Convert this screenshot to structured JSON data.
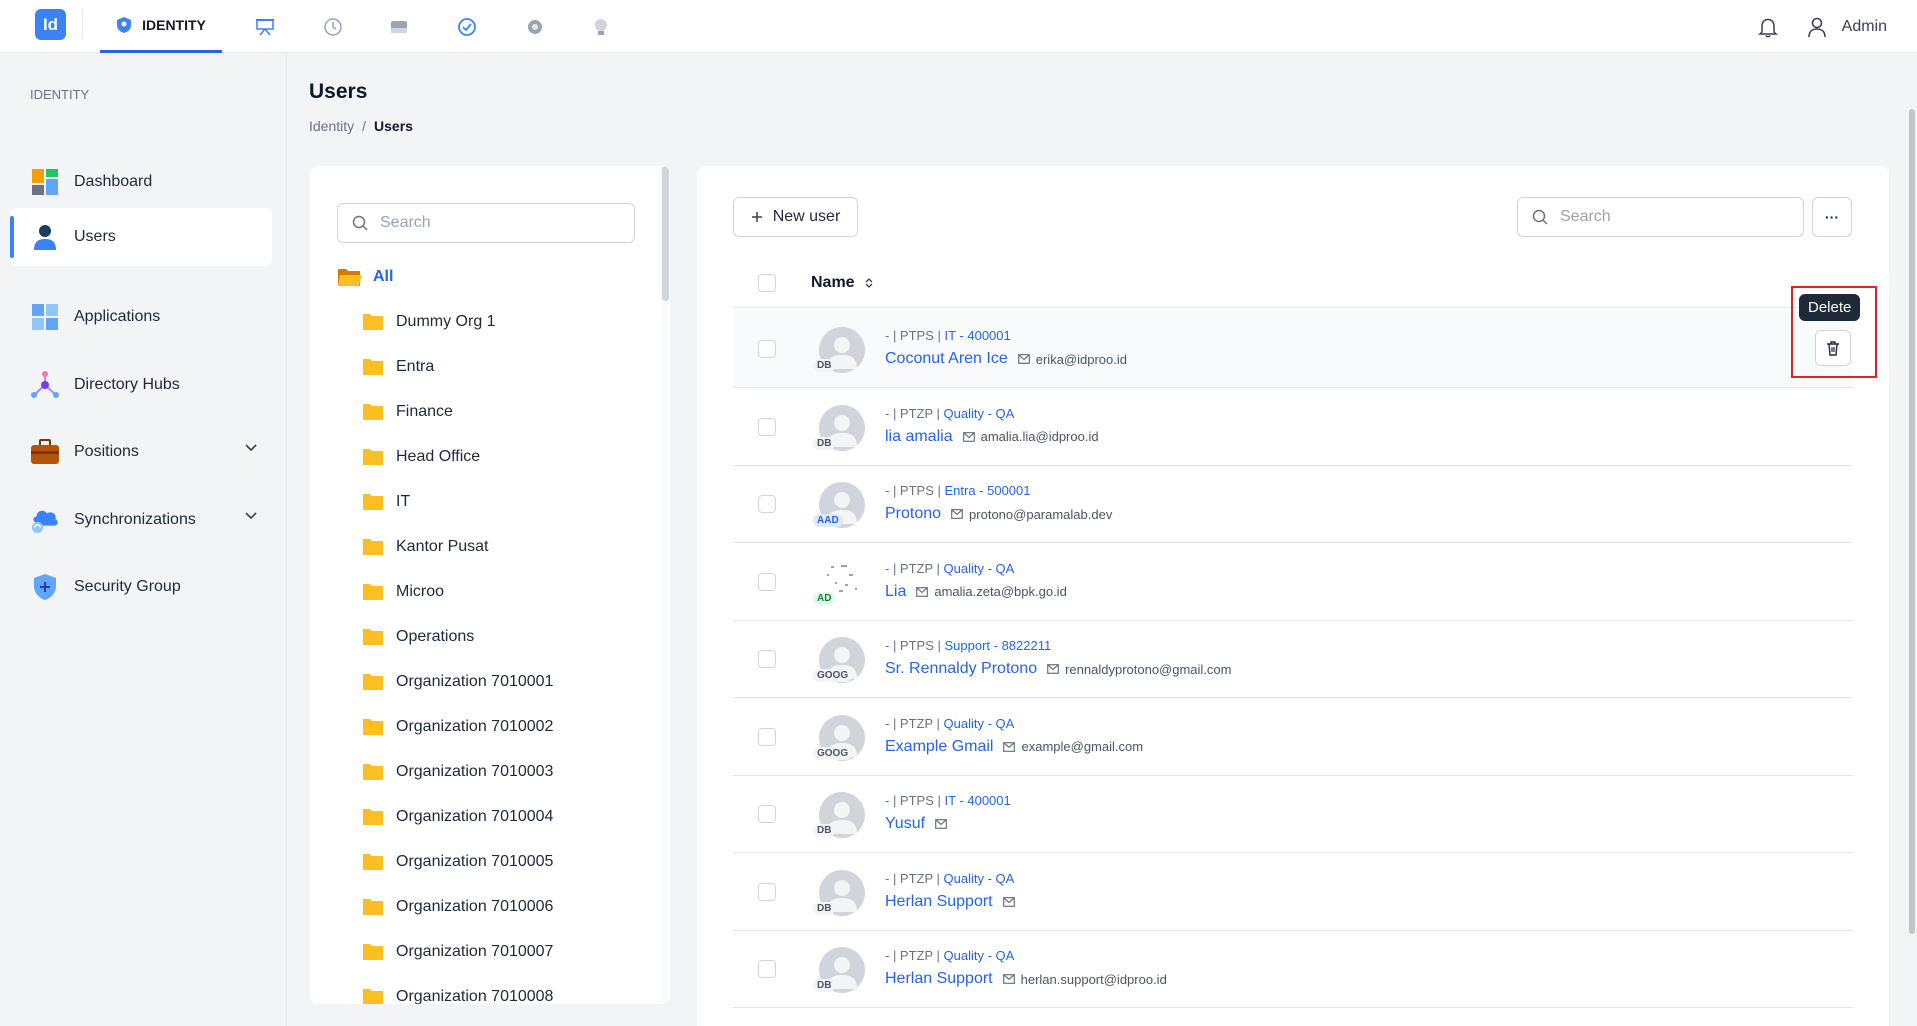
{
  "topbar": {
    "logo": "Id",
    "active_tab": "IDENTITY",
    "icons": [
      "shield-icon",
      "presentation-icon",
      "clock-icon",
      "drive-icon",
      "badge-check-icon",
      "gear-icon",
      "lightbulb-icon"
    ],
    "user": "Admin"
  },
  "sidebar": {
    "section": "IDENTITY",
    "items": [
      {
        "label": "Dashboard",
        "icon": "dashboard-icon"
      },
      {
        "label": "Users",
        "icon": "user-icon",
        "active": true
      },
      {
        "label": "Applications",
        "icon": "apps-icon"
      },
      {
        "label": "Directory Hubs",
        "icon": "hub-icon"
      },
      {
        "label": "Positions",
        "icon": "briefcase-icon",
        "expandable": true
      },
      {
        "label": "Synchronizations",
        "icon": "cloud-sync-icon",
        "expandable": true
      },
      {
        "label": "Security Group",
        "icon": "shield-plus-icon"
      }
    ]
  },
  "page": {
    "title": "Users",
    "breadcrumb": [
      "Identity",
      "/",
      "Users"
    ]
  },
  "tree": {
    "search_placeholder": "Search",
    "all_label": "All",
    "folders": [
      "Dummy Org 1",
      "Entra",
      "Finance",
      "Head Office",
      "IT",
      "Kantor Pusat",
      "Microo",
      "Operations",
      "Organization 7010001",
      "Organization 7010002",
      "Organization 7010003",
      "Organization 7010004",
      "Organization 7010005",
      "Organization 7010006",
      "Organization 7010007",
      "Organization 7010008"
    ]
  },
  "users": {
    "new_user_label": "New user",
    "search_placeholder": "Search",
    "more_label": "···",
    "column_name": "Name",
    "tooltip": "Delete",
    "rows": [
      {
        "meta_prefix": "- | PTPS | ",
        "dept": "IT - 400001",
        "name": "Coconut Aren Ice",
        "email": "erika@idproo.id",
        "badge": "DB"
      },
      {
        "meta_prefix": "- | PTZP | ",
        "dept": "Quality - QA",
        "name": "lia amalia",
        "email": "amalia.lia@idproo.id",
        "badge": "DB"
      },
      {
        "meta_prefix": "- | PTPS | ",
        "dept": "Entra - 500001",
        "name": "Protono",
        "email": "protono@paramalab.dev",
        "badge": "AAD"
      },
      {
        "meta_prefix": "- | PTZP | ",
        "dept": "Quality - QA",
        "name": "Lia",
        "email": "amalia.zeta@bpk.go.id",
        "badge": "AD"
      },
      {
        "meta_prefix": "- | PTPS | ",
        "dept": "Support - 8822211",
        "name": "Sr. Rennaldy Protono",
        "email": "rennaldyprotono@gmail.com",
        "badge": "GOOG"
      },
      {
        "meta_prefix": "- | PTZP | ",
        "dept": "Quality - QA",
        "name": "Example Gmail",
        "email": "example@gmail.com",
        "badge": "GOOG"
      },
      {
        "meta_prefix": "- | PTPS | ",
        "dept": "IT - 400001",
        "name": "Yusuf",
        "email": "",
        "badge": "DB"
      },
      {
        "meta_prefix": "- | PTZP | ",
        "dept": "Quality - QA",
        "name": "Herlan Support",
        "email": "",
        "badge": "DB"
      },
      {
        "meta_prefix": "- | PTZP | ",
        "dept": "Quality - QA",
        "name": "Herlan Support",
        "email": "herlan.support@idproo.id",
        "badge": "DB"
      }
    ]
  },
  "colors": {
    "accent": "#2563eb",
    "highlight": "#dc2626"
  }
}
